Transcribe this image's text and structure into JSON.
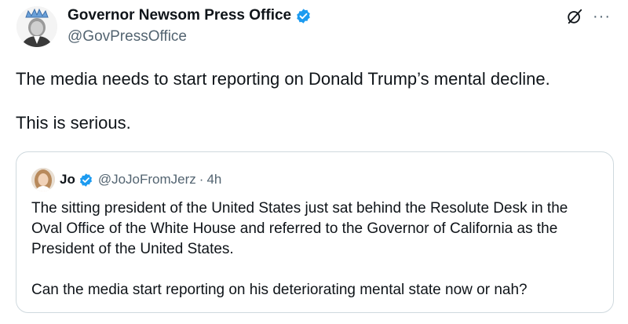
{
  "author": {
    "name": "Governor Newsom Press Office",
    "handle": "@GovPressOffice",
    "verified_icon": "verified-badge-icon"
  },
  "header_icons": {
    "grok": "grok-icon",
    "more": "···"
  },
  "tweet": {
    "paragraphs": [
      "The media needs to start reporting on Donald Trump’s mental decline.",
      "This is serious."
    ]
  },
  "quoted_tweet": {
    "name": "Jo",
    "handle": "@JoJoFromJerz",
    "separator": "·",
    "time": "4h",
    "paragraphs": [
      "The sitting president of the United States just sat behind the Resolute Desk in the Oval Office of the White House and referred to the Governor of California as the President of the United States.",
      "Can the media start reporting on his deteriorating mental state now or nah?"
    ]
  },
  "colors": {
    "text": "#0f1419",
    "secondary": "#536471",
    "verified": "#1d9bf0",
    "border": "#cfd9de"
  }
}
